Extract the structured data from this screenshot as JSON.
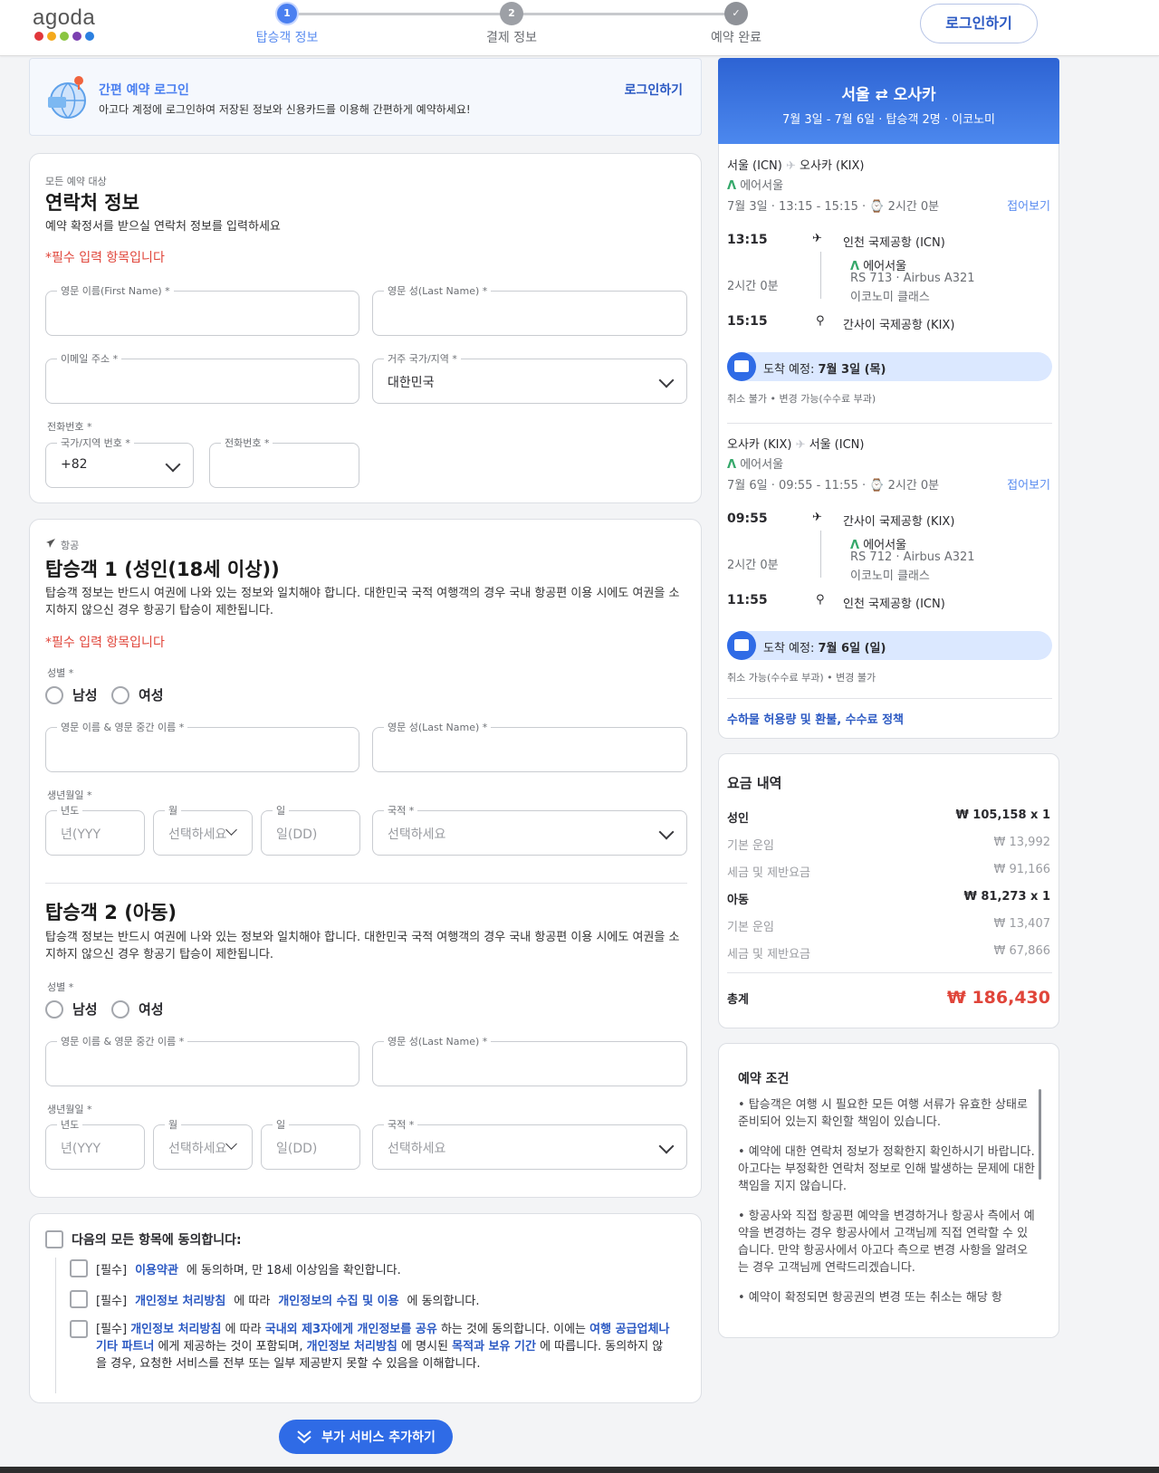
{
  "header": {
    "logo": "agoda",
    "logo_dots": [
      "#e1373b",
      "#f4a91c",
      "#8ac541",
      "#7b3fb0",
      "#2b80e0"
    ],
    "steps": [
      {
        "num": "1",
        "label": "탑승객 정보",
        "state": "active"
      },
      {
        "num": "2",
        "label": "결제 정보",
        "state": "pending"
      },
      {
        "num": "✓",
        "label": "예약 완료",
        "state": "pending"
      }
    ],
    "login_label": "로그인하기"
  },
  "banner": {
    "title": "간편 예약 로그인",
    "desc": "아고다 계정에 로그인하여 저장된 정보와 신용카드를 이용해 간편하게 예약하세요!",
    "link": "로그인하기"
  },
  "contact": {
    "overline": "모든 예약 대상",
    "title": "연락처 정보",
    "desc": "예약 확정서를 받으실 연락처 정보를 입력하세요",
    "required_note": "*필수 입력 항목입니다",
    "first_name_label": "영문 이름(First Name) *",
    "last_name_label": "영문 성(Last Name) *",
    "email_label": "이메일 주소 *",
    "country_label": "거주 국가/지역 *",
    "country_value": "대한민국",
    "phone_group_label": "전화번호 *",
    "phone_code_label": "국가/지역 번호 *",
    "phone_code_value": "+82",
    "phone_label": "전화번호 *"
  },
  "passenger1": {
    "overline": "항공",
    "title": "탑승객 1 (성인(18세 이상))",
    "desc": "탑승객 정보는 반드시 여권에 나와 있는 정보와 일치해야 합니다. 대한민국 국적 여행객의 경우 국내 항공편 이용 시에도 여권을 소지하지 않으신 경우 항공기 탑승이 제한됩니다.",
    "required_note": "*필수 입력 항목입니다",
    "gender_label": "성별 *",
    "male": "남성",
    "female": "여성",
    "first_name_label": "영문 이름 & 영문 중간 이름 *",
    "last_name_label": "영문 성(Last Name) *",
    "dob_label": "생년월일 *",
    "year_label": "년도",
    "year_ph": "년(YYY",
    "month_label": "월",
    "month_ph": "선택하세요",
    "day_label": "일",
    "day_ph": "일(DD)",
    "nationality_label": "국적 *",
    "nationality_ph": "선택하세요"
  },
  "passenger2": {
    "title": "탑승객 2 (아동)",
    "desc": "탑승객 정보는 반드시 여권에 나와 있는 정보와 일치해야 합니다. 대한민국 국적 여행객의 경우 국내 항공편 이용 시에도 여권을 소지하지 않으신 경우 항공기 탑승이 제한됩니다.",
    "gender_label": "성별 *",
    "male": "남성",
    "female": "여성",
    "first_name_label": "영문 이름 & 영문 중간 이름 *",
    "last_name_label": "영문 성(Last Name) *",
    "dob_label": "생년월일 *",
    "year_label": "년도",
    "year_ph": "년(YYY",
    "month_label": "월",
    "month_ph": "선택하세요",
    "day_label": "일",
    "day_ph": "일(DD)",
    "nationality_label": "국적 *",
    "nationality_ph": "선택하세요"
  },
  "agree": {
    "all": "다음의 모든 항목에 동의합니다:",
    "item1": {
      "pre": "[필수]",
      "link": "이용약관",
      "post": "에 동의하며, 만 18세 이상임을 확인합니다."
    },
    "item2": {
      "pre": "[필수]",
      "link1": "개인정보 처리방침",
      "mid": "에 따라",
      "link2": "개인정보의 수집 및 이용",
      "post": "에 동의합니다."
    },
    "item3": {
      "pre": "[필수]",
      "link1": "개인정보 처리방침",
      "mid1": "에 따라",
      "link2": "국내외 제3자에게 개인정보를 공유",
      "mid2": "하는 것에 동의합니다. 이에는",
      "link3": "여행 공급업체나 기타 파트너",
      "mid3": "에게 제공하는 것이 포함되며,",
      "link4": "개인정보 처리방침",
      "mid4": "에 명시된",
      "link5": "목적과 보유 기간",
      "post": "에 따릅니다. 동의하지 않을 경우, 요청한 서비스를 전부 또는 일부 제공받지 못할 수 있음을 이해합니다."
    }
  },
  "cta_label": "부가 서비스 추가하기",
  "itinerary": {
    "route": "서울 ⇄ 오사카",
    "summary": "7월 3일 - 7월 6일 · 탑승객 2명 · 이코노미",
    "legs": [
      {
        "from": "서울 (ICN)",
        "to": "오사카 (KIX)",
        "airline": "에어서울",
        "meta": "7월 3일 · 13:15 - 15:15 · ⌚ 2시간 0분",
        "collapse": "접어보기",
        "dep_time": "13:15",
        "dep_airport": "인천 국제공항 (ICN)",
        "duration": "2시간 0분",
        "flight": "RS 713 · Airbus A321",
        "cabin": "이코노미 클래스",
        "arr_time": "15:15",
        "arr_airport": "간사이 국제공항 (KIX)",
        "arrive_label": "도착 예정:",
        "arrive_date": "7월 3일 (목)",
        "policy": "취소 불가 • 변경 가능(수수료 부과)"
      },
      {
        "from": "오사카 (KIX)",
        "to": "서울 (ICN)",
        "airline": "에어서울",
        "meta": "7월 6일 · 09:55 - 11:55 · ⌚ 2시간 0분",
        "collapse": "접어보기",
        "dep_time": "09:55",
        "dep_airport": "간사이 국제공항 (KIX)",
        "duration": "2시간 0분",
        "flight": "RS 712 · Airbus A321",
        "cabin": "이코노미 클래스",
        "arr_time": "11:55",
        "arr_airport": "인천 국제공항 (ICN)",
        "arrive_label": "도착 예정:",
        "arrive_date": "7월 6일 (일)",
        "policy": "취소 가능(수수료 부과) • 변경 불가"
      }
    ],
    "baggage_link": "수하물 허용량 및 환불, 수수료 정책"
  },
  "price": {
    "title": "요금 내역",
    "adult_label": "성인",
    "adult_value": "₩ 105,158 x 1",
    "adult_base_label": "기본 운임",
    "adult_base_value": "₩ 13,992",
    "adult_tax_label": "세금 및 제반요금",
    "adult_tax_value": "₩ 91,166",
    "child_label": "아동",
    "child_value": "₩ 81,273 x 1",
    "child_base_label": "기본 운임",
    "child_base_value": "₩ 13,407",
    "child_tax_label": "세금 및 제반요금",
    "child_tax_value": "₩ 67,866",
    "total_label": "총계",
    "total_value": "₩ 186,430"
  },
  "conditions": {
    "title": "예약 조건",
    "items": [
      "• 탑승객은 여행 시 필요한 모든 여행 서류가 유효한 상태로 준비되어 있는지 확인할 책임이 있습니다.",
      "• 예약에 대한 연락처 정보가 정확한지 확인하시기 바랍니다. 아고다는 부정확한 연락처 정보로 인해 발생하는 문제에 대한 책임을 지지 않습니다.",
      "• 항공사와 직접 항공편 예약을 변경하거나 항공사 측에서 예약을 변경하는 경우 항공사에서 고객님께 직접 연락할 수 있습니다. 만약 항공사에서 아고다 측으로 변경 사항을 알려오는 경우 고객님께 연락드리겠습니다.",
      "• 예약이 확정되면 항공권의 변경 또는 취소는 해당 항"
    ]
  },
  "colors": {
    "accent": "#2f6be6",
    "brand_blue": "#2b59c3",
    "total_red": "#e0453a"
  }
}
